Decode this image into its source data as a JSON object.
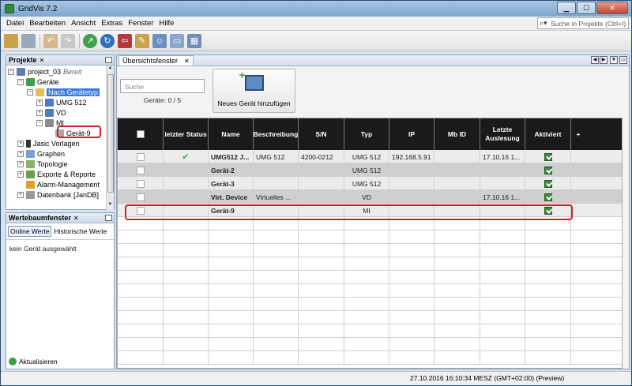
{
  "window": {
    "title": "GridVis 7.2"
  },
  "menu": [
    "Datei",
    "Bearbeiten",
    "Ansicht",
    "Extras",
    "Fenster",
    "Hilfe"
  ],
  "global_search": {
    "placeholder": "Suche in Projekte (Ctrl+I)"
  },
  "projects_panel": {
    "title": "Projekte",
    "tree": [
      {
        "label": "project_03",
        "note": "Bereit"
      },
      {
        "label": "Geräte"
      },
      {
        "label": "Nach Gerätetyp"
      },
      {
        "label": "UMG 512"
      },
      {
        "label": "VD"
      },
      {
        "label": "MI"
      },
      {
        "label": "Gerät-9"
      },
      {
        "label": "Jasic Vorlagen"
      },
      {
        "label": "Graphen"
      },
      {
        "label": "Topologie"
      },
      {
        "label": "Exporte & Reporte"
      },
      {
        "label": "Alarm-Management"
      },
      {
        "label": "Datenbank [JanDB]"
      }
    ]
  },
  "values_panel": {
    "title": "Wertebaumfenster",
    "tab_online": "Online Werte",
    "tab_history": "Historische Werte",
    "empty_text": "kein Gerät ausgewählt",
    "refresh": "Aktualisieren"
  },
  "overview": {
    "tab": "Übersichtsfenster",
    "search_placeholder": "Suche",
    "device_count": "Geräte: 0 / 5",
    "add_device": "Neues Gerät hinzufügen",
    "columns": [
      "",
      "letzter Status",
      "Name",
      "Beschreibung",
      "S/N",
      "Typ",
      "IP",
      "Mb ID",
      "Letzte Auslesung",
      "Aktiviert"
    ],
    "rows": [
      {
        "status": "✔",
        "name": "UMG512 J...",
        "desc": "UMG 512",
        "sn": "4200-0212",
        "type": "UMG 512",
        "ip": "192.168.5.91",
        "mbid": "",
        "last": "17.10.16 1...",
        "active": true
      },
      {
        "status": "",
        "name": "Gerät-2",
        "desc": "",
        "sn": "",
        "type": "UMG 512",
        "ip": "",
        "mbid": "",
        "last": "",
        "active": true
      },
      {
        "status": "",
        "name": "Gerät-3",
        "desc": "",
        "sn": "",
        "type": "UMG 512",
        "ip": "",
        "mbid": "",
        "last": "",
        "active": true
      },
      {
        "status": "",
        "name": "Virt. Device",
        "desc": "Virtuelles ...",
        "sn": "",
        "type": "VD",
        "ip": "",
        "mbid": "",
        "last": "17.10.16 1...",
        "active": true
      },
      {
        "status": "",
        "name": "Gerät-9",
        "desc": "",
        "sn": "",
        "type": "MI",
        "ip": "",
        "mbid": "",
        "last": "",
        "active": true
      }
    ]
  },
  "statusbar": {
    "text": "27.10.2016 16:10:34 MESZ (GMT+02:00)   (Preview)"
  }
}
